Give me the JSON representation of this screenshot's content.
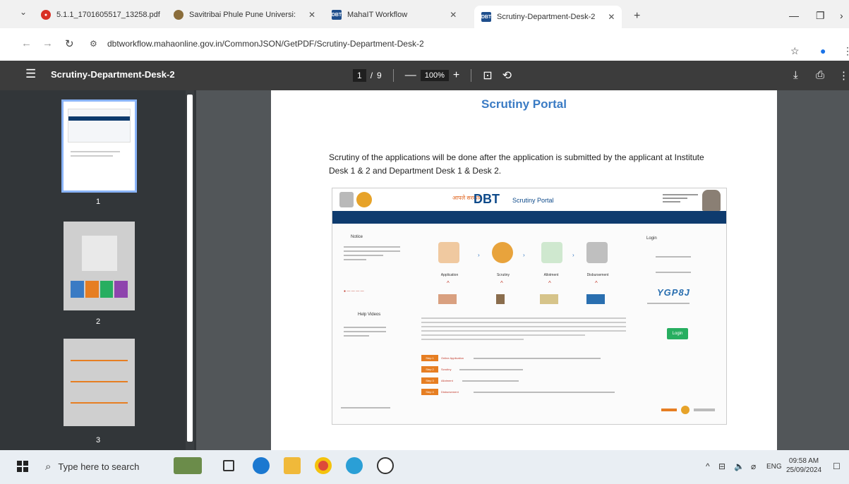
{
  "browser": {
    "tabs": [
      {
        "title": "5.1.1_1701605517_13258.pdf",
        "icon": "pdf-icon"
      },
      {
        "title": "Savitribai Phule Pune Universi:",
        "icon": "university-icon"
      },
      {
        "title": "MahaIT Workflow",
        "icon": "dbt-icon"
      },
      {
        "title": "Scrutiny-Department-Desk-2",
        "icon": "dbt-icon"
      }
    ],
    "url": "dbtworkflow.mahaonline.gov.in/CommonJSON/GetPDF/Scrutiny-Department-Desk-2"
  },
  "viewer": {
    "doc_title": "Scrutiny-Department-Desk-2",
    "page_current": "1",
    "page_sep": "/",
    "page_total": "9",
    "zoom": "100%",
    "minus": "—",
    "plus": "+",
    "thumbnails": [
      "1",
      "2",
      "3"
    ]
  },
  "page": {
    "title": "Scrutiny Portal",
    "body": "Scrutiny of the applications will be done after the application is submitted by the applicant at Institute Desk 1 & 2 and Department Desk 1 & Desk 2."
  },
  "embedded": {
    "dbt_prefix": "आपले सरकार",
    "dbt": "DBT",
    "portal": "Scrutiny Portal",
    "notice": "Notice",
    "help_videos": "Help Videos",
    "login": "Login",
    "captcha": "YGP8J",
    "login_button": "Login",
    "steps": [
      "Application",
      "Scrutiny",
      "Allotment",
      "Disbursement"
    ],
    "step_badges": [
      "Step 1",
      "Step 2",
      "Step 3",
      "Step 4"
    ],
    "step_text": [
      "Online Application",
      "Scrutiny",
      "Allotment",
      "Disbursement"
    ]
  },
  "taskbar": {
    "search_placeholder": "Type here to search",
    "language": "ENG",
    "time": "09:58 AM",
    "date": "25/09/2024"
  },
  "colors": {
    "portal_title": "#3a7bc4",
    "dbt_blue": "#0e3b6e",
    "step_orange": "#e67e22",
    "login_green": "#27ae60"
  }
}
